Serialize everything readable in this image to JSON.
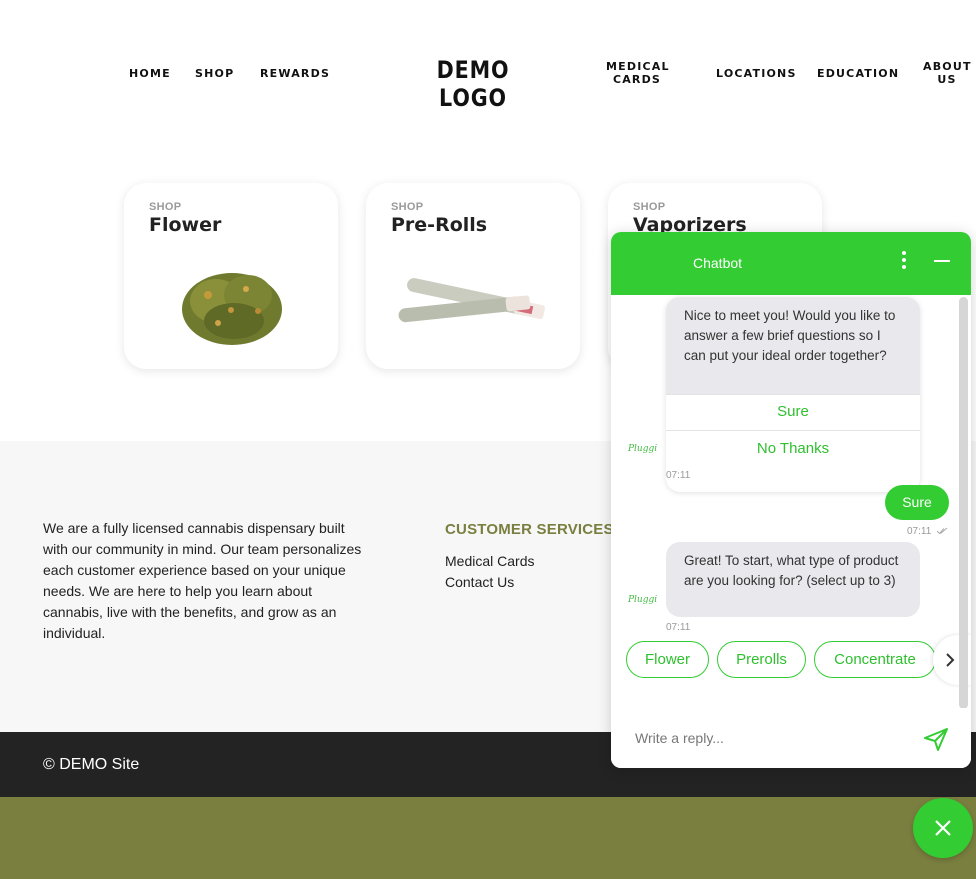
{
  "nav": {
    "home": "HOME",
    "shop": "SHOP",
    "rewards": "REWARDS",
    "logo": "DEMO LOGO",
    "medical_cards_1": "MEDICAL",
    "medical_cards_2": "CARDS",
    "locations": "LOCATIONS",
    "education": "EDUCATION",
    "about_1": "ABOUT",
    "about_2": "US"
  },
  "cards": [
    {
      "kicker": "SHOP",
      "title": "Flower",
      "icon": "flower-bud-image"
    },
    {
      "kicker": "SHOP",
      "title": "Pre-Rolls",
      "icon": "pre-roll-image"
    },
    {
      "kicker": "SHOP",
      "title": "Vaporizers",
      "icon": "vaporizer-image"
    }
  ],
  "footer": {
    "about": "We are a fully licensed cannabis dispensary built with our community in mind. Our team personalizes each customer experience based on your unique needs. We are here to help you learn about cannabis, live with the benefits, and grow as an individual.",
    "customer_services_heading": "CUSTOMER SERVICES",
    "links": [
      "Medical Cards",
      "Contact Us"
    ],
    "copyright": "© DEMO Site"
  },
  "chat": {
    "title": "Chatbot",
    "accent": "#33cc33",
    "brand": "Pluggi",
    "msg1": "Nice to meet you! Would you like to answer a few brief questions so I can put your ideal order together?",
    "opt_sure": "Sure",
    "opt_no": "No Thanks",
    "time1": "07:11",
    "user_reply": "Sure",
    "time2": "07:11",
    "msg2": "Great! To start,  what type of product are you looking for? (select up to 3)",
    "time3": "07:11",
    "chips": [
      "Flower",
      "Prerolls",
      "Concentrate"
    ],
    "reply_placeholder": "Write a reply..."
  },
  "colors": {
    "olive": "#7a7f3f",
    "dark_footer": "#232323",
    "chat_green": "#33cc33"
  }
}
